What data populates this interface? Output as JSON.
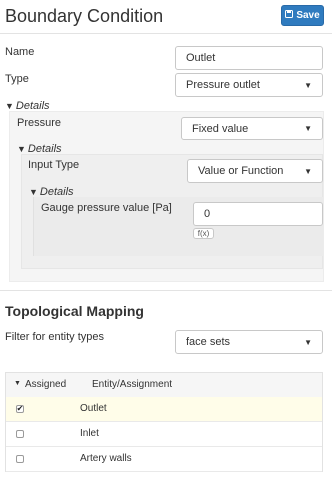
{
  "header": {
    "title": "Boundary Condition",
    "save_label": "Save"
  },
  "form": {
    "name_label": "Name",
    "name_value": "Outlet",
    "type_label": "Type",
    "type_value": "Pressure outlet",
    "details_label": "Details",
    "pressure_label": "Pressure",
    "pressure_value": "Fixed value",
    "details2_label": "Details",
    "input_type_label": "Input Type",
    "input_type_value": "Value or Function",
    "details3_label": "Details",
    "gauge_label": "Gauge pressure value [Pa]",
    "gauge_value": "0",
    "fx_label": "f(x)"
  },
  "topological": {
    "title": "Topological Mapping",
    "filter_label": "Filter for entity types",
    "filter_value": "face sets",
    "col_assigned": "Assigned",
    "col_entity": "Entity/Assignment",
    "rows": [
      {
        "name": "Outlet",
        "checked": true
      },
      {
        "name": "Inlet",
        "checked": false
      },
      {
        "name": "Artery walls",
        "checked": false
      }
    ]
  },
  "colors": {
    "accent": "#2f7bbf",
    "selected_row": "#fffde9"
  },
  "icons": [
    "save-icon",
    "chevron-down-icon",
    "triangle-down-icon",
    "checkbox-icon"
  ]
}
